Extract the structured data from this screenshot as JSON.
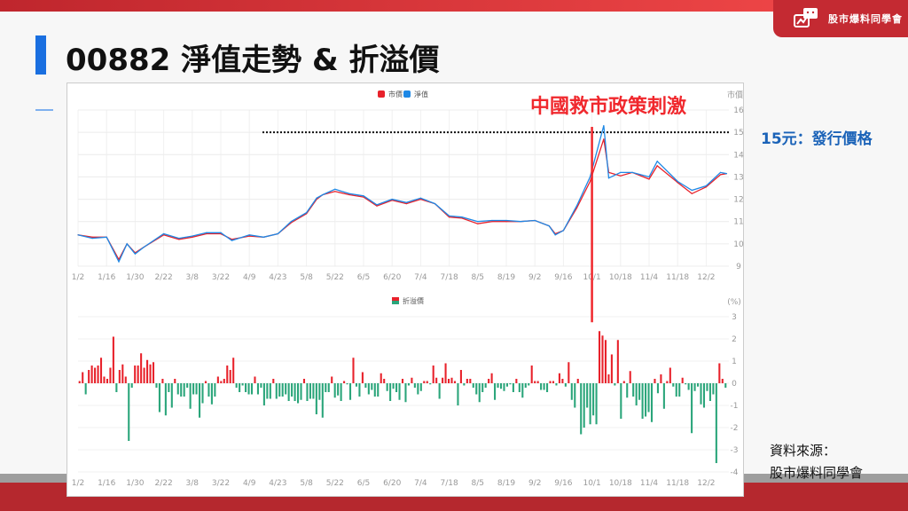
{
  "header": {
    "title": "00882 淨值走勢 & 折溢價",
    "logo_text": "股市爆料同學會"
  },
  "annotations": {
    "event": "中國救市政策刺激",
    "issue_price": "15元：發行價格"
  },
  "source": {
    "label": "資料來源：",
    "name": "股市爆料同學會"
  },
  "colors": {
    "market_price": "#e8222b",
    "nav": "#1e88e5",
    "premium": "#e8222b",
    "discount": "#2aa57a",
    "brand_red": "#b5282e",
    "title_accent": "#1a6fe0"
  },
  "chart_data": [
    {
      "type": "line",
      "year": 2024,
      "y_axis_title": "市價",
      "ylim": [
        9,
        16
      ],
      "yticks": [
        9,
        10,
        11,
        12,
        13,
        14,
        15,
        16
      ],
      "x_ticks": [
        "1/2",
        "1/16",
        "1/30",
        "2/22",
        "3/8",
        "3/22",
        "4/9",
        "4/23",
        "5/8",
        "5/22",
        "6/5",
        "6/20",
        "7/4",
        "7/18",
        "8/5",
        "8/19",
        "9/2",
        "9/16",
        "10/1",
        "10/18",
        "11/4",
        "11/18",
        "12/2"
      ],
      "grid": true,
      "legend_position": "top-center",
      "reference_line": {
        "y": 15,
        "style": "dotted"
      },
      "series": [
        {
          "name": "市價",
          "points": [
            [
              "1/2",
              10.4
            ],
            [
              "1/9",
              10.3
            ],
            [
              "1/16",
              10.3
            ],
            [
              "1/22",
              9.3
            ],
            [
              "1/26",
              10.0
            ],
            [
              "1/30",
              9.6
            ],
            [
              "2/6",
              9.85
            ],
            [
              "2/22",
              10.4
            ],
            [
              "3/1",
              10.2
            ],
            [
              "3/8",
              10.3
            ],
            [
              "3/15",
              10.45
            ],
            [
              "3/22",
              10.45
            ],
            [
              "3/29",
              10.2
            ],
            [
              "4/9",
              10.35
            ],
            [
              "4/16",
              10.3
            ],
            [
              "4/23",
              10.45
            ],
            [
              "4/30",
              10.95
            ],
            [
              "5/8",
              11.35
            ],
            [
              "5/13",
              12.0
            ],
            [
              "5/16",
              12.2
            ],
            [
              "5/22",
              12.35
            ],
            [
              "5/29",
              12.2
            ],
            [
              "6/5",
              12.1
            ],
            [
              "6/12",
              11.7
            ],
            [
              "6/20",
              11.95
            ],
            [
              "6/27",
              11.8
            ],
            [
              "7/4",
              12.0
            ],
            [
              "7/11",
              11.8
            ],
            [
              "7/18",
              11.2
            ],
            [
              "7/26",
              11.15
            ],
            [
              "8/5",
              10.9
            ],
            [
              "8/12",
              11.0
            ],
            [
              "8/19",
              11.0
            ],
            [
              "8/26",
              11.0
            ],
            [
              "9/2",
              11.05
            ],
            [
              "9/9",
              10.8
            ],
            [
              "9/12",
              10.45
            ],
            [
              "9/16",
              10.6
            ],
            [
              "9/23",
              11.6
            ],
            [
              "9/30",
              12.8
            ],
            [
              "10/8",
              14.7
            ],
            [
              "10/11",
              13.2
            ],
            [
              "10/18",
              13.05
            ],
            [
              "10/25",
              13.2
            ],
            [
              "11/4",
              12.9
            ],
            [
              "11/8",
              13.5
            ],
            [
              "11/18",
              12.75
            ],
            [
              "11/25",
              12.25
            ],
            [
              "12/2",
              12.55
            ],
            [
              "12/9",
              13.1
            ],
            [
              "12/12",
              13.15
            ]
          ]
        },
        {
          "name": "淨值",
          "points": [
            [
              "1/2",
              10.4
            ],
            [
              "1/9",
              10.25
            ],
            [
              "1/16",
              10.3
            ],
            [
              "1/22",
              9.2
            ],
            [
              "1/26",
              10.0
            ],
            [
              "1/30",
              9.55
            ],
            [
              "2/6",
              9.85
            ],
            [
              "2/22",
              10.45
            ],
            [
              "3/1",
              10.25
            ],
            [
              "3/8",
              10.35
            ],
            [
              "3/15",
              10.5
            ],
            [
              "3/22",
              10.5
            ],
            [
              "3/29",
              10.15
            ],
            [
              "4/9",
              10.4
            ],
            [
              "4/16",
              10.3
            ],
            [
              "4/23",
              10.45
            ],
            [
              "4/30",
              11.0
            ],
            [
              "5/8",
              11.4
            ],
            [
              "5/13",
              12.05
            ],
            [
              "5/16",
              12.2
            ],
            [
              "5/22",
              12.45
            ],
            [
              "5/29",
              12.25
            ],
            [
              "6/5",
              12.15
            ],
            [
              "6/12",
              11.75
            ],
            [
              "6/20",
              12.0
            ],
            [
              "6/27",
              11.85
            ],
            [
              "7/4",
              12.05
            ],
            [
              "7/11",
              11.8
            ],
            [
              "7/18",
              11.25
            ],
            [
              "7/26",
              11.2
            ],
            [
              "8/5",
              11.0
            ],
            [
              "8/12",
              11.05
            ],
            [
              "8/19",
              11.05
            ],
            [
              "8/26",
              11.0
            ],
            [
              "9/2",
              11.05
            ],
            [
              "9/9",
              10.8
            ],
            [
              "9/12",
              10.4
            ],
            [
              "9/16",
              10.6
            ],
            [
              "9/23",
              11.7
            ],
            [
              "9/30",
              13.0
            ],
            [
              "10/8",
              15.3
            ],
            [
              "10/11",
              12.95
            ],
            [
              "10/18",
              13.2
            ],
            [
              "10/25",
              13.2
            ],
            [
              "11/4",
              13.0
            ],
            [
              "11/8",
              13.7
            ],
            [
              "11/18",
              12.8
            ],
            [
              "11/25",
              12.4
            ],
            [
              "12/2",
              12.6
            ],
            [
              "12/9",
              13.2
            ],
            [
              "12/12",
              13.15
            ]
          ]
        }
      ]
    },
    {
      "type": "bar",
      "series_name": "折溢價",
      "y_unit": "(%)",
      "ylim": [
        -4,
        3
      ],
      "yticks": [
        3,
        2,
        1,
        0,
        -1,
        -2,
        -3,
        -4
      ],
      "x_ticks": [
        "1/2",
        "1/16",
        "1/30",
        "2/22",
        "3/8",
        "3/22",
        "4/9",
        "4/23",
        "5/8",
        "5/22",
        "6/5",
        "6/20",
        "7/4",
        "7/18",
        "8/5",
        "8/19",
        "9/2",
        "9/16",
        "10/1",
        "10/18",
        "11/4",
        "11/18",
        "12/2"
      ],
      "grid": true,
      "legend_position": "top-center",
      "highlight": {
        "date": "10/1",
        "value": 2.75
      },
      "values": [
        0.1,
        0.5,
        -0.5,
        0.6,
        0.8,
        0.7,
        0.8,
        1.15,
        0.3,
        0.2,
        0.7,
        2.1,
        -0.4,
        0.6,
        0.85,
        0.3,
        -2.6,
        -0.2,
        0.8,
        0.8,
        1.35,
        0.7,
        1.05,
        0.85,
        0.95,
        -0.2,
        -1.3,
        0.2,
        -1.45,
        -0.4,
        -1.1,
        0.2,
        -0.5,
        -0.6,
        -0.6,
        -0.2,
        -1.15,
        -0.5,
        -0.5,
        -1.55,
        -0.9,
        0.1,
        -0.6,
        -0.95,
        -0.6,
        0.3,
        0.1,
        0.2,
        0.8,
        0.6,
        1.15,
        -0.2,
        -0.4,
        -0.1,
        -0.4,
        -0.5,
        -0.5,
        0.3,
        -0.5,
        -0.2,
        -1.0,
        -0.7,
        -0.7,
        0.2,
        -0.7,
        -0.6,
        -0.6,
        -0.5,
        -0.8,
        -0.6,
        -0.8,
        -0.9,
        -0.75,
        0.2,
        -0.8,
        -0.7,
        -0.7,
        -1.4,
        -0.75,
        -1.55,
        -0.4,
        -0.4,
        0.3,
        -0.65,
        -0.55,
        -0.8,
        0.1,
        -0.05,
        -0.75,
        1.15,
        -0.15,
        -0.6,
        0.5,
        -0.2,
        -0.5,
        -0.3,
        -0.6,
        -0.6,
        0.45,
        0.2,
        -0.35,
        -0.8,
        -0.25,
        -0.4,
        -0.75,
        0.2,
        -0.85,
        -0.1,
        0.25,
        -0.2,
        -0.5,
        -0.35,
        0.1,
        0.1,
        -0.05,
        0.8,
        0.25,
        -0.7,
        0.25,
        0.9,
        0.2,
        0.25,
        0.1,
        -1.0,
        0.6,
        -0.1,
        0.2,
        0.2,
        -0.2,
        -0.5,
        -0.85,
        -0.4,
        -0.2,
        0.2,
        0.45,
        -0.75,
        -0.2,
        -0.25,
        -0.35,
        -0.15,
        -0.05,
        -0.4,
        0.2,
        -0.4,
        -0.65,
        -0.2,
        -0.1,
        0.8,
        0.1,
        0.1,
        -0.3,
        -0.3,
        -0.4,
        0.1,
        0.1,
        -0.1,
        0.45,
        0.2,
        -0.15,
        0.95,
        -0.75,
        -1.1,
        0.2,
        -2.3,
        -2.0,
        -1.1,
        -1.85,
        -1.45,
        -1.85,
        2.35,
        2.15,
        1.95,
        0.4,
        1.3,
        -0.1,
        1.95,
        -1.6,
        0.1,
        -0.65,
        0.55,
        -0.6,
        -1.0,
        -0.75,
        -1.6,
        -1.5,
        -1.3,
        -1.75,
        0.2,
        -0.45,
        0.4,
        -1.15,
        0.1,
        0.7,
        -0.15,
        -0.6,
        -0.6,
        0.25,
        -0.05,
        -0.3,
        -2.25,
        -0.35,
        -0.15,
        -0.95,
        -1.1,
        -0.35,
        -0.8,
        -0.5,
        -3.6,
        0.9,
        0.2,
        -0.2
      ]
    }
  ]
}
